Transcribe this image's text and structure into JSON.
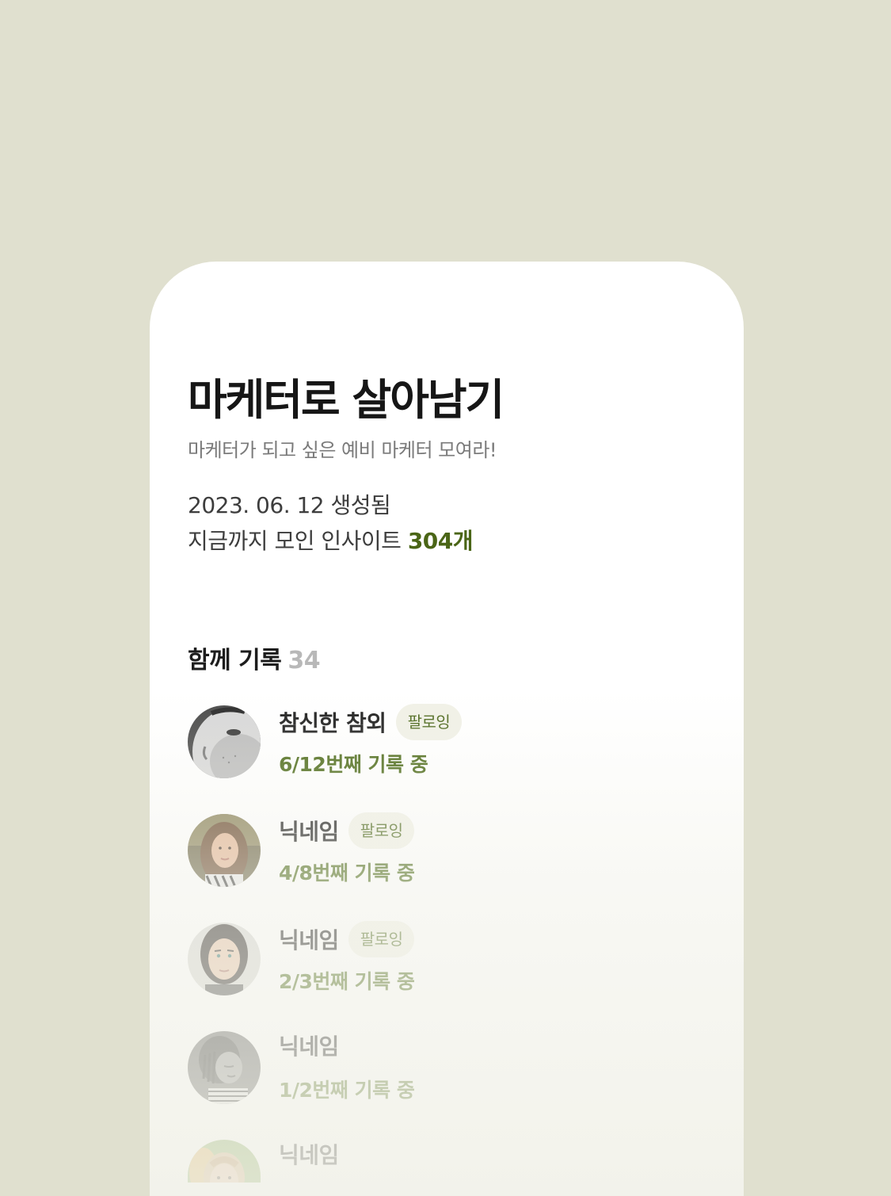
{
  "group": {
    "title": "마케터로 살아남기",
    "description": "마케터가 되고 싶은 예비 마케터 모여라!",
    "created": "2023. 06. 12 생성됨",
    "insights_prefix": "지금까지 모인 인사이트",
    "insights_count": "304개"
  },
  "members_section": {
    "title": "함께 기록",
    "count": "34"
  },
  "members": [
    {
      "name": "참신한 참외",
      "badge": "팔로잉",
      "progress": "6/12번째 기록 중"
    },
    {
      "name": "닉네임",
      "badge": "팔로잉",
      "progress": "4/8번째 기록 중"
    },
    {
      "name": "닉네임",
      "badge": "팔로잉",
      "progress": "2/3번째 기록 중"
    },
    {
      "name": "닉네임",
      "badge": "",
      "progress": "1/2번째 기록 중"
    },
    {
      "name": "닉네임",
      "badge": "",
      "progress": ""
    }
  ],
  "colors": {
    "background": "#e0e0cf",
    "accent": "#4a6516",
    "badge_bg": "#f1f1e7"
  }
}
